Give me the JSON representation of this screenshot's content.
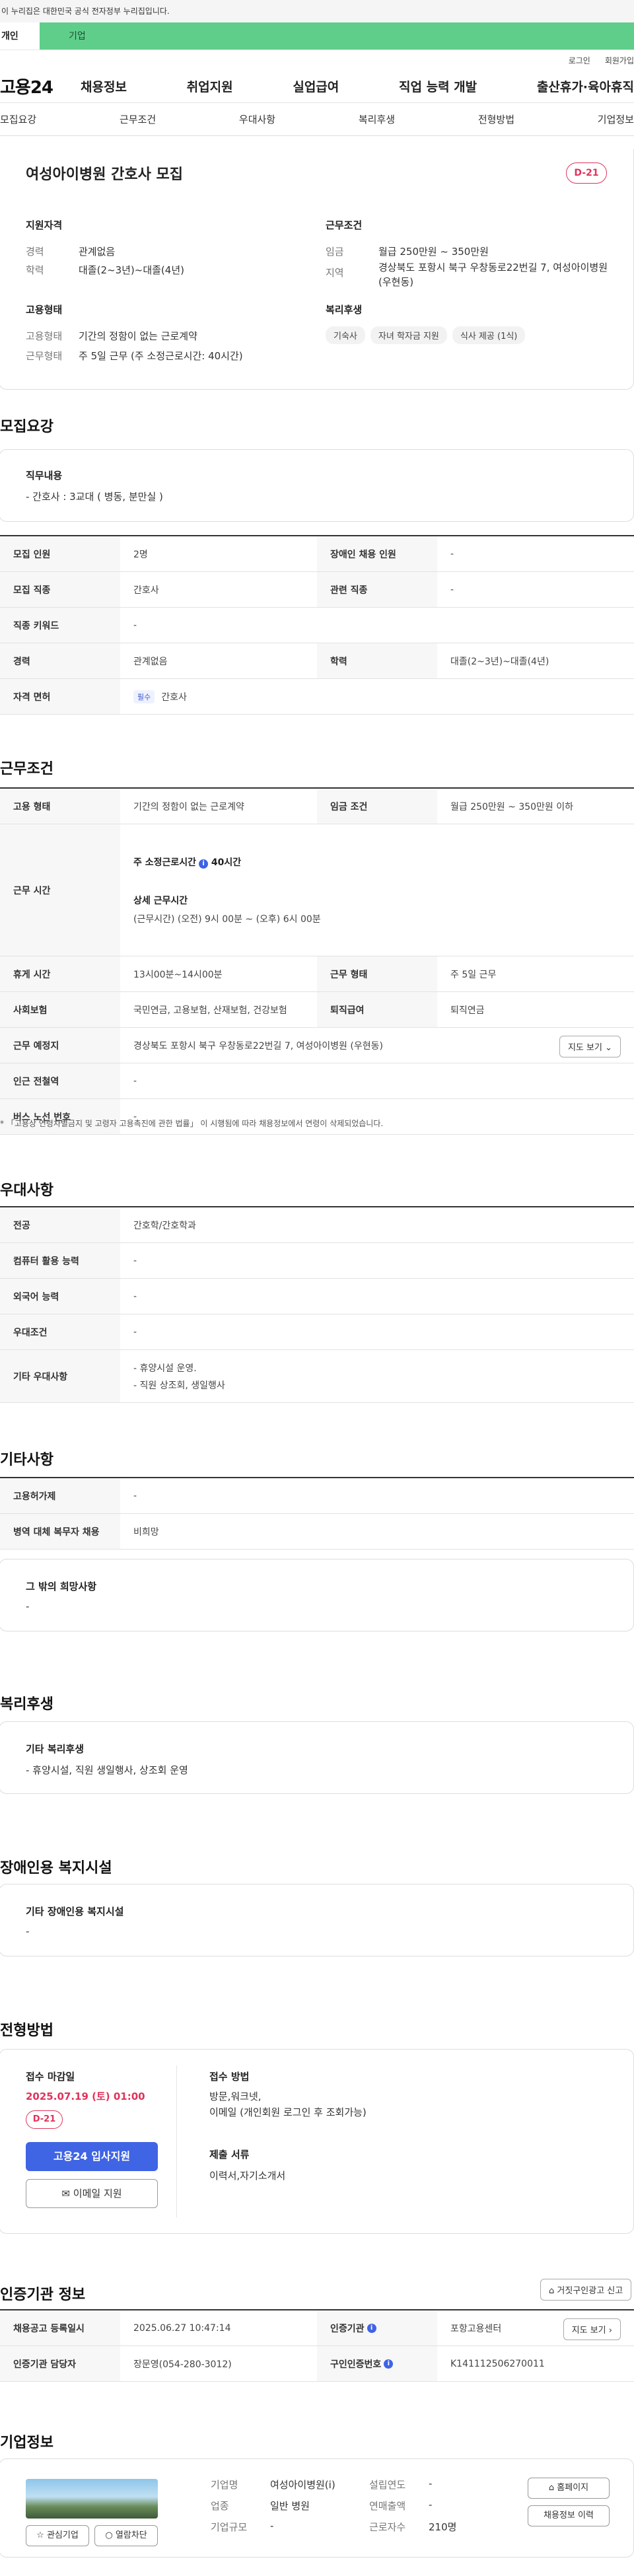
{
  "gov_banner": "이 누리집은 대한민국 공식 전자정부 누리집입니다.",
  "site_tabs": {
    "personal": "개인",
    "business": "기업"
  },
  "util": {
    "login": "로그인",
    "join": "회원가입"
  },
  "gnb": {
    "logo": "고용24",
    "menu": [
      "채용정보",
      "취업지원",
      "실업급여",
      "직업 능력 개발",
      "출산휴가·육아휴직"
    ]
  },
  "anchor": [
    "모집요강",
    "근무조건",
    "우대사항",
    "복리후생",
    "전형방법",
    "기업정보"
  ],
  "summary": {
    "title": "여성아이병원 간호사 모집",
    "dday": "D-21",
    "qual_head": "지원자격",
    "career_lbl": "경력",
    "career": "관계없음",
    "edu_lbl": "학력",
    "edu": "대졸(2~3년)~대졸(4년)",
    "cond_head": "근무조건",
    "wage_lbl": "임금",
    "wage": "월급 250만원 ~ 350만원",
    "loc_lbl": "지역",
    "loc": "경상북도 포항시 북구 우창동로22번길 7, 여성아이병원 (우현동)",
    "emp_head": "고용형태",
    "emp_type_lbl": "고용형태",
    "emp_type": "기간의 정함이 없는 근로계약",
    "work_lbl": "근무형태",
    "work": "주 5일 근무 (주 소정근로시간: 40시간)",
    "welfare_head": "복리후생",
    "chips": [
      "기숙사",
      "자녀 학자금 지원",
      "식사 제공 (1식)"
    ]
  },
  "recruit": {
    "section": "모집요강",
    "duty_head": "직무내용",
    "duty": "- 간호사 : 3교대 ( 병동, 분만실 )",
    "rows": {
      "count_lbl": "모집 인원",
      "count": "2명",
      "disabled_lbl": "장애인 채용 인원",
      "disabled": "-",
      "job_lbl": "모집 직종",
      "job": "간호사",
      "rel_lbl": "관련 직종",
      "rel": "-",
      "kw_lbl": "직종 키워드",
      "kw": "-",
      "career_lbl": "경력",
      "career": "관계없음",
      "edu_lbl": "학력",
      "edu": "대졸(2~3년)~대졸(4년)",
      "license_lbl": "자격 면허",
      "license_tag": "필수",
      "license": "간호사"
    }
  },
  "conditions": {
    "section": "근무조건",
    "emp_lbl": "고용 형태",
    "emp": "기간의 정함이 없는 근로계약",
    "wage_lbl": "임금 조건",
    "wage": "월급 250만원 ~ 350만원 이하",
    "time_lbl": "근무 시간",
    "weekly_label": "주 소정근로시간",
    "weekly_val": "40시간",
    "detail_head": "상세 근무시간",
    "detail": "(근무시간) (오전) 9시 00분 ~ (오후) 6시 00분",
    "rest_lbl": "휴게 시간",
    "rest": "13시00분~14시00분",
    "worktype_lbl": "근무 형태",
    "worktype": "주 5일 근무",
    "insure_lbl": "사회보험",
    "insure": "국민연금, 고용보험, 산재보험, 건강보험",
    "retire_lbl": "퇴직급여",
    "retire": "퇴직연금",
    "place_lbl": "근무 예정지",
    "place": "경상북도 포항시 북구 우창동로22번길 7, 여성아이병원 (우현동)",
    "map_btn": "지도 보기",
    "subway_lbl": "인근 전철역",
    "subway": "-",
    "bus_lbl": "버스 노선 번호",
    "bus": "-",
    "note": "* 「고용상 연령차별금지 및 고령자 고용촉진에 관한 법률」 이 시행됨에 따라 채용정보에서 연령이 삭제되었습니다."
  },
  "prefer": {
    "section": "우대사항",
    "major_lbl": "전공",
    "major": "간호학/간호학과",
    "pc_lbl": "컴퓨터 활용 능력",
    "pc": "-",
    "lang_lbl": "외국어 능력",
    "lang": "-",
    "cond_lbl": "우대조건",
    "cond": "-",
    "etc_lbl": "기타 우대사항",
    "etc1": "- 휴양시설 운영.",
    "etc2": "- 직원 상조회, 생일행사"
  },
  "other": {
    "section": "기타사항",
    "permit_lbl": "고용허가제",
    "permit": "-",
    "military_lbl": "병역 대체 복무자 채용",
    "military": "비희망",
    "wish_head": "그 밖의 희망사항",
    "wish": "-"
  },
  "welfare": {
    "section": "복리후생",
    "head": "기타 복리후생",
    "body": "- 휴양시설, 직원 생일행사, 상조회 운영"
  },
  "disabled_fac": {
    "section": "장애인용 복지시설",
    "head": "기타 장애인용 복지시설",
    "body": "-"
  },
  "process": {
    "section": "전형방법",
    "deadline_head": "접수 마감일",
    "deadline": "2025.07.19 (토) 01:00",
    "dday": "D-21",
    "apply_btn": "고용24 입사지원",
    "email_btn": "이메일 지원",
    "method_head": "접수 방법",
    "method1": "방문,워크넷,",
    "method2": "이메일 (개인회원 로그인 후 조회가능)",
    "docs_head": "제출 서류",
    "docs": "이력서,자기소개서"
  },
  "agency": {
    "section": "인증기관 정보",
    "report_btn": "거짓구인광고 신고",
    "reg_lbl": "채용공고 등록일시",
    "reg": "2025.06.27 10:47:14",
    "agency_lbl": "인증기관",
    "agency": "포항고용센터",
    "map_btn": "지도 보기",
    "manager_lbl": "인증기관 담당자",
    "manager": "장문영(054-280-3012)",
    "no_lbl": "구인인증번호",
    "no": "K141112506270011"
  },
  "company": {
    "section": "기업정보",
    "name_lbl": "기업명",
    "name": "여성아이병원(i)",
    "year_lbl": "설립연도",
    "year": "-",
    "type_lbl": "업종",
    "type": "일반 병원",
    "sales_lbl": "연매출액",
    "sales": "-",
    "size_lbl": "기업규모",
    "size": "-",
    "staff_lbl": "근로자수",
    "staff": "210명",
    "interest_btn": "관심기업",
    "block_btn": "열람차단",
    "home_btn": "홈페이지",
    "history_btn": "채용정보 이력"
  }
}
